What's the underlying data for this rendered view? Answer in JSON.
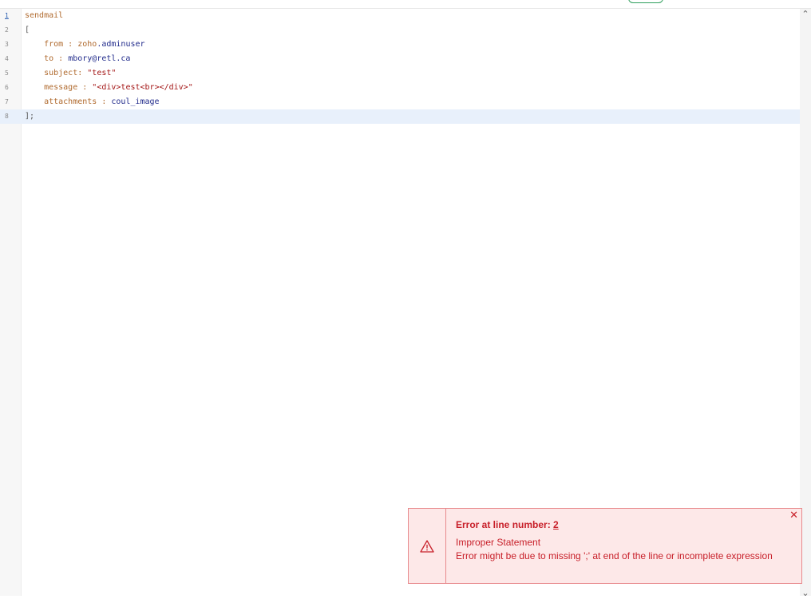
{
  "editor": {
    "lines": [
      {
        "num": "1",
        "tokens": [
          {
            "t": "sendmail",
            "c": "kw"
          }
        ]
      },
      {
        "num": "2",
        "tokens": [
          {
            "t": "[",
            "c": "punct"
          }
        ]
      },
      {
        "num": "3",
        "tokens": [
          {
            "t": "    from : ",
            "c": "kw"
          },
          {
            "t": "zoho",
            "c": "kw"
          },
          {
            "t": ".adminuser",
            "c": "ident"
          }
        ]
      },
      {
        "num": "4",
        "tokens": [
          {
            "t": "    to : ",
            "c": "kw"
          },
          {
            "t": "mbory@retl.ca",
            "c": "ident"
          }
        ]
      },
      {
        "num": "5",
        "tokens": [
          {
            "t": "    subject: ",
            "c": "kw"
          },
          {
            "t": "\"test\"",
            "c": "str"
          }
        ]
      },
      {
        "num": "6",
        "tokens": [
          {
            "t": "    message : ",
            "c": "kw"
          },
          {
            "t": "\"<div>test<br></div>\"",
            "c": "str"
          }
        ]
      },
      {
        "num": "7",
        "tokens": [
          {
            "t": "    attachments : ",
            "c": "kw"
          },
          {
            "t": "coul_image",
            "c": "ident"
          }
        ]
      },
      {
        "num": "8",
        "tokens": [
          {
            "t": "];",
            "c": "punct"
          }
        ]
      }
    ],
    "current_line": "1",
    "active_line": "8"
  },
  "error": {
    "title": "Error at line number: ",
    "line_number": "2",
    "type": "Improper Statement",
    "description": "Error might be due to missing ';' at end of the line or incomplete expression",
    "close_symbol": "✕",
    "icon": "warning-triangle-icon",
    "color": "#c8202a",
    "background": "#fde8e8"
  },
  "scrollbar": {
    "up_symbol": "⌃",
    "down_symbol": "⌄"
  }
}
